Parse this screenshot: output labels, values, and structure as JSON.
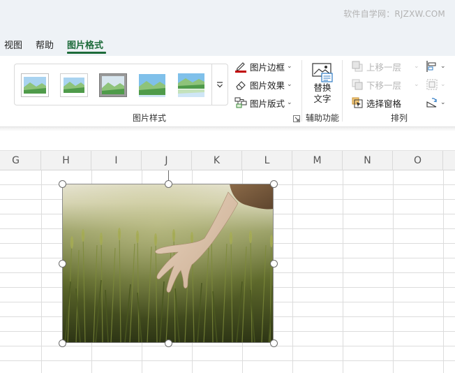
{
  "watermark": "软件自学网：RJZXW.COM",
  "tabs": [
    {
      "label": "视图"
    },
    {
      "label": "帮助"
    },
    {
      "label": "图片格式",
      "active": true
    }
  ],
  "ribbon": {
    "picture_styles": {
      "label": "图片样式",
      "commands": {
        "border": "图片边框",
        "effects": "图片效果",
        "layout": "图片版式"
      }
    },
    "accessibility": {
      "label": "辅助功能",
      "alt_text_line1": "替换",
      "alt_text_line2": "文字"
    },
    "arrange": {
      "label": "排列",
      "bring_forward": "上移一层",
      "send_backward": "下移一层",
      "selection_pane": "选择窗格"
    }
  },
  "columns": [
    "G",
    "H",
    "I",
    "J",
    "K",
    "L",
    "M",
    "N",
    "O"
  ],
  "colors": {
    "accent": "#1d6b3a",
    "border_red": "#c00000",
    "disabled_text": "#b5b5b5"
  }
}
